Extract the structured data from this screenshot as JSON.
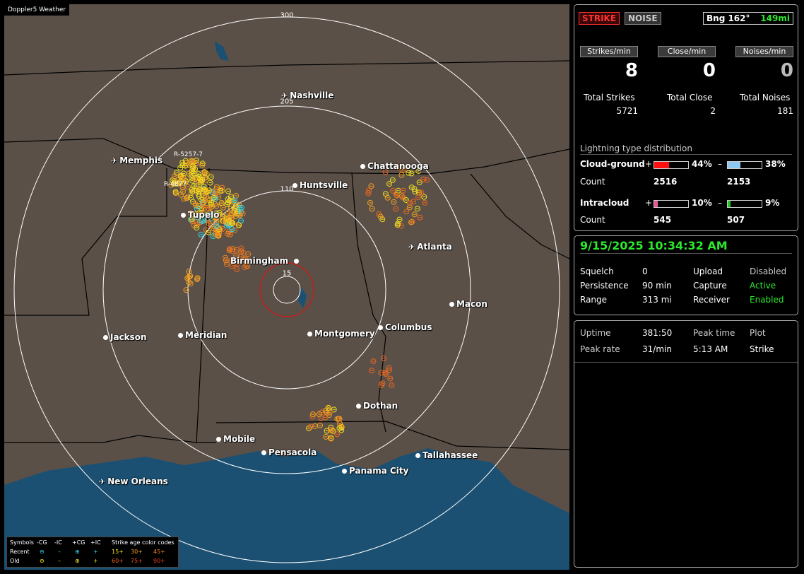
{
  "map": {
    "title": "Doppler5 Weather",
    "rings": [
      {
        "label": "15"
      },
      {
        "label": "110"
      },
      {
        "label": "205"
      },
      {
        "label": "300"
      }
    ],
    "cities": [
      {
        "name": "Nashville",
        "type": "airport"
      },
      {
        "name": "Memphis",
        "type": "airport"
      },
      {
        "name": "Chattanooga",
        "type": "city"
      },
      {
        "name": "Huntsville",
        "type": "city"
      },
      {
        "name": "Tupelo",
        "type": "city"
      },
      {
        "name": "Atlanta",
        "type": "airport"
      },
      {
        "name": "Birmingham",
        "type": "city"
      },
      {
        "name": "Macon",
        "type": "city"
      },
      {
        "name": "Jackson",
        "type": "city"
      },
      {
        "name": "Meridian",
        "type": "city"
      },
      {
        "name": "Montgomery",
        "type": "city"
      },
      {
        "name": "Columbus",
        "type": "city"
      },
      {
        "name": "Dothan",
        "type": "city"
      },
      {
        "name": "Mobile",
        "type": "city"
      },
      {
        "name": "Pensacola",
        "type": "city"
      },
      {
        "name": "Tallahassee",
        "type": "city"
      },
      {
        "name": "Panama City",
        "type": "city"
      },
      {
        "name": "New Orleans",
        "type": "airport"
      }
    ],
    "storm_labels": [
      "R-5257-7",
      "R-4877"
    ],
    "legend": {
      "symbols_label": "Symbols",
      "cols": [
        "-CG",
        "-IC",
        "+CG",
        "+IC"
      ],
      "age_label": "Strike age color codes",
      "recent_label": "Recent",
      "old_label": "Old",
      "recent_ages": [
        "15+",
        "30+",
        "45+"
      ],
      "old_ages": [
        "60+",
        "75+",
        "90+"
      ]
    }
  },
  "stats": {
    "strike_btn": "STRIKE",
    "noise_btn": "NOISE",
    "bearing": "Bng 162°",
    "distance": "149mi",
    "strikes_min_label": "Strikes/min",
    "close_min_label": "Close/min",
    "noises_min_label": "Noises/min",
    "strikes_min": "8",
    "close_min": "0",
    "noises_min": "0",
    "total_strikes_label": "Total Strikes",
    "total_close_label": "Total Close",
    "total_noises_label": "Total Noises",
    "total_strikes": "5721",
    "total_close": "2",
    "total_noises": "181",
    "distribution_title": "Lightning type distribution",
    "cg_label": "Cloud-ground",
    "ic_label": "Intracloud",
    "count_label": "Count",
    "plus": "+",
    "minus": "–",
    "cg_pos_pct": "44%",
    "cg_neg_pct": "38%",
    "ic_pos_pct": "10%",
    "ic_neg_pct": "9%",
    "cg_pos_level": 0.44,
    "cg_neg_level": 0.38,
    "ic_pos_level": 0.1,
    "ic_neg_level": 0.09,
    "cg_pos_count": "2516",
    "cg_neg_count": "2153",
    "ic_pos_count": "545",
    "ic_neg_count": "507"
  },
  "status": {
    "datetime": "9/15/2025 10:34:32 AM",
    "squelch_label": "Squelch",
    "squelch": "0",
    "persistence_label": "Persistence",
    "persistence": "90 min",
    "range_label": "Range",
    "range": "313 mi",
    "upload_label": "Upload",
    "upload": "Disabled",
    "capture_label": "Capture",
    "capture": "Active",
    "receiver_label": "Receiver",
    "receiver": "Enabled"
  },
  "uptime": {
    "uptime_label": "Uptime",
    "uptime": "381:50",
    "peak_time_label": "Peak time",
    "peak_time": "5:13 AM",
    "plot_label": "Plot",
    "plot": "Strike",
    "peak_rate_label": "Peak rate",
    "peak_rate": "31/min"
  },
  "colors": {
    "map_land": "#5b5048",
    "water": "#1b5072",
    "cg_pos_bar": "#ff1010",
    "cg_neg_bar": "#8ec8f0",
    "ic_pos_bar": "#e8579e",
    "ic_neg_bar": "#22c422",
    "active_green": "#2ee82e"
  }
}
